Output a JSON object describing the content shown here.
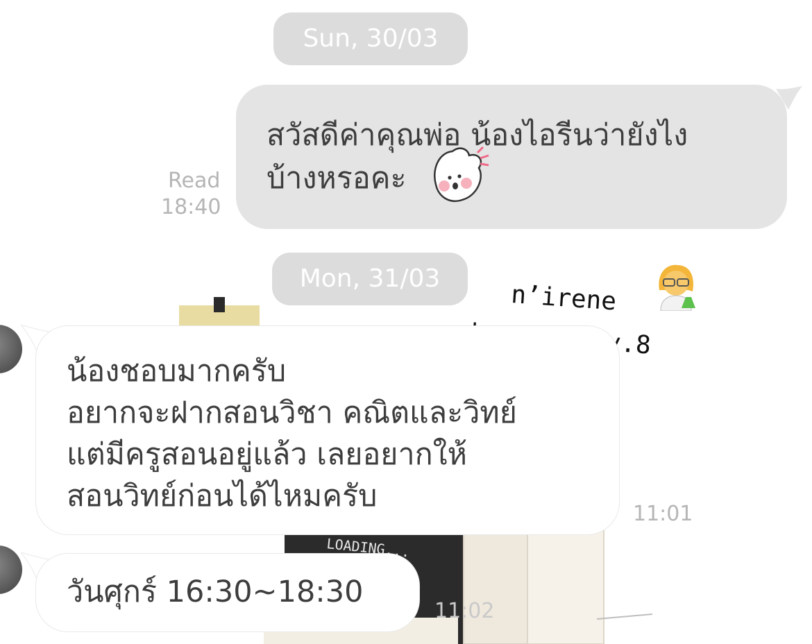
{
  "dates": {
    "first": "Sun, 30/03",
    "second": "Mon, 31/03"
  },
  "messages": {
    "out1": {
      "lines": [
        "สวัสดีค่าคุณพ่อ น้องไอรีนว่ายังไง",
        "บ้างหรอคะ"
      ],
      "status": "Read",
      "time": "18:40",
      "sticker": "bunny-sticker-icon"
    },
    "in1": {
      "lines": [
        "น้องชอบมากครับ",
        "อยากจะฝากสอนวิชา คณิตและวิทย์",
        "แต่มีครูสอนอยู่แล้ว เลยอยากให้",
        "สอนวิทย์ก่อนได้ไหมครับ"
      ],
      "time": "11:01"
    },
    "in2": {
      "text": "วันศุกร์ 16:30~18:30",
      "time": "11:02"
    }
  },
  "overlay": {
    "line1": "n’irene",
    "line2": "chemistry y.8",
    "emoji": "woman-scientist-icon"
  },
  "background": {
    "sign_text": "LOADING..."
  },
  "colors": {
    "outgoing_bubble": "#e4e4e4",
    "incoming_bubble": "#ffffff",
    "date_pill": "#dcdcdc"
  }
}
